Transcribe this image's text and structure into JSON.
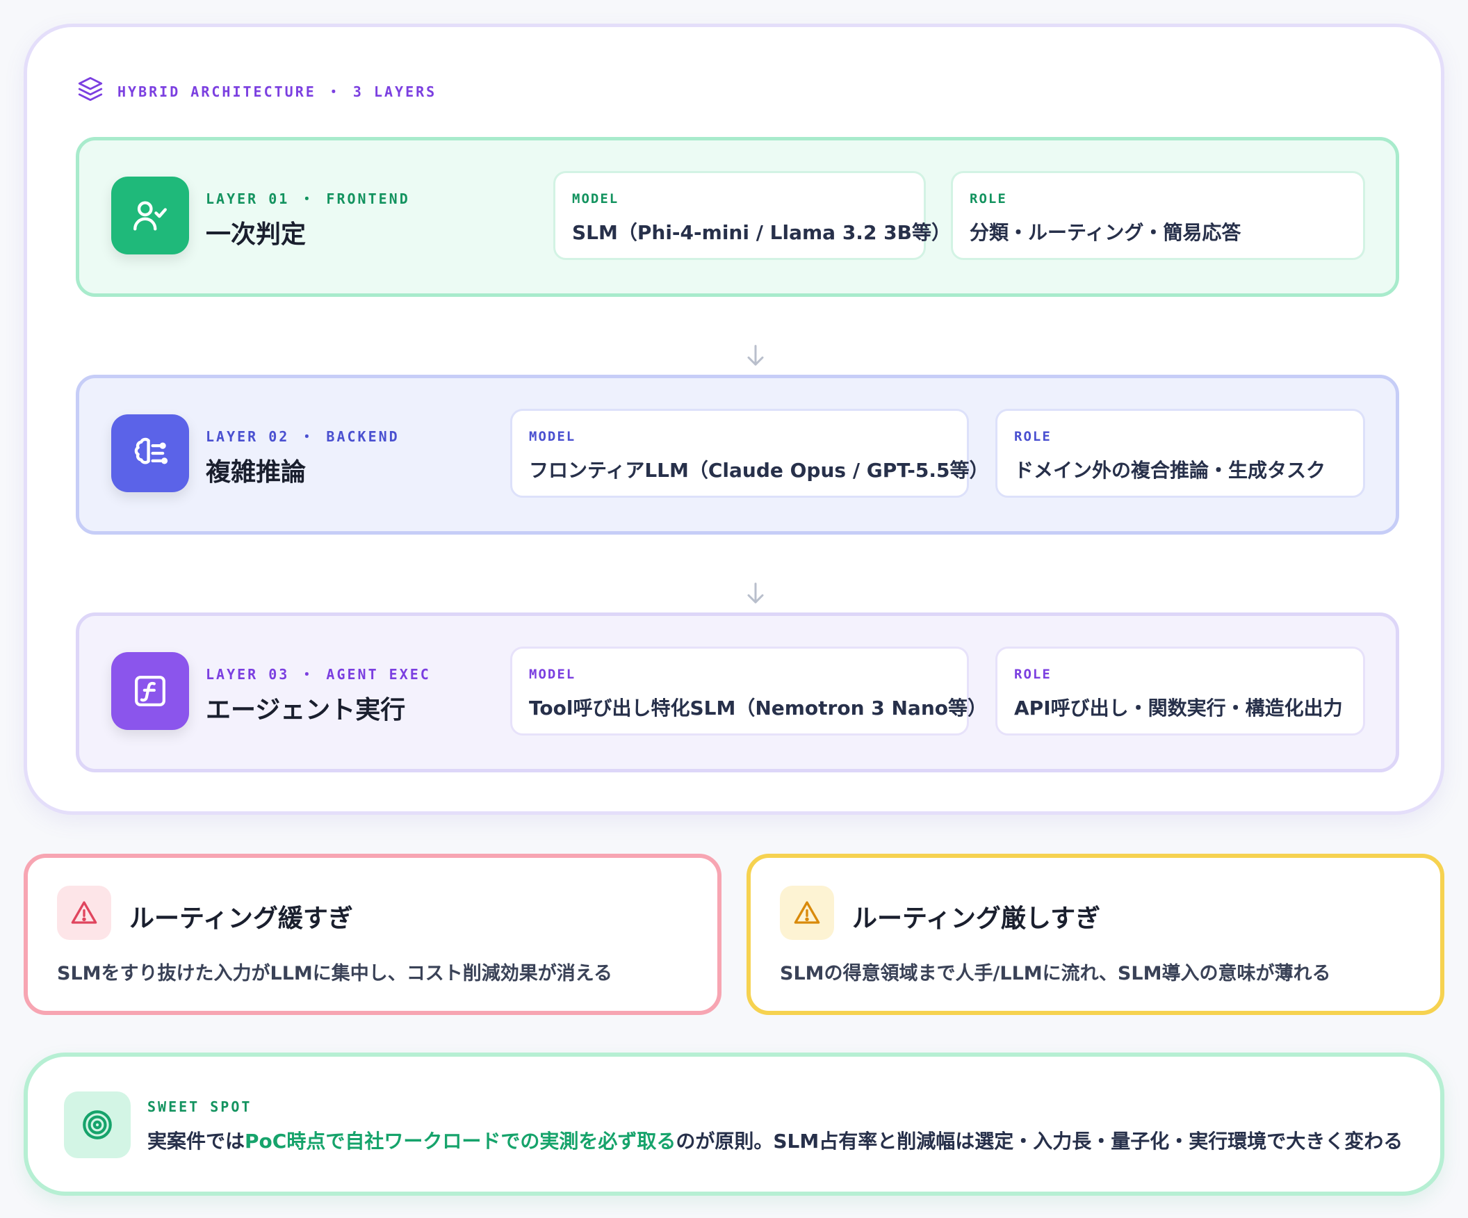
{
  "architecture": {
    "header_label": "HYBRID ARCHITECTURE ・ 3 LAYERS",
    "layers": [
      {
        "eyebrow": "LAYER 01 ・ FRONTEND",
        "title": "一次判定",
        "model_key": "MODEL",
        "model_value": "SLM（Phi-4-mini / Llama 3.2 3B等）",
        "role_key": "ROLE",
        "role_value": "分類・ルーティング・簡易応答",
        "icon": "user-check-icon",
        "accent": "#1fb97a"
      },
      {
        "eyebrow": "LAYER 02 ・ BACKEND",
        "title": "複雑推論",
        "model_key": "MODEL",
        "model_value": "フロンティアLLM（Claude Opus / GPT-5.5等）",
        "role_key": "ROLE",
        "role_value": "ドメイン外の複合推論・生成タスク",
        "icon": "brain-icon",
        "accent": "#5b63e8"
      },
      {
        "eyebrow": "LAYER 03 ・ AGENT EXEC",
        "title": "エージェント実行",
        "model_key": "MODEL",
        "model_value": "Tool呼び出し特化SLM（Nemotron 3 Nano等）",
        "role_key": "ROLE",
        "role_value": "API呼び出し・関数実行・構造化出力",
        "icon": "function-icon",
        "accent": "#8b55ec"
      }
    ]
  },
  "warnings": {
    "loose": {
      "title": "ルーティング緩すぎ",
      "body": "SLMをすり抜けた入力がLLMに集中し、コスト削減効果が消える",
      "accent": "#e0455e"
    },
    "strict": {
      "title": "ルーティング厳しすぎ",
      "body": "SLMの得意領域まで人手/LLMに流れ、SLM導入の意味が薄れる",
      "accent": "#d98a0b"
    }
  },
  "sweet_spot": {
    "eyebrow": "SWEET SPOT",
    "text_before": "実案件では",
    "text_highlight": "PoC時点で自社ワークロードでの実測を必ず取る",
    "text_after": "のが原則。SLM占有率と削減幅は選定・入力長・量子化・実行環境で大きく変わる",
    "accent": "#16a36b"
  }
}
